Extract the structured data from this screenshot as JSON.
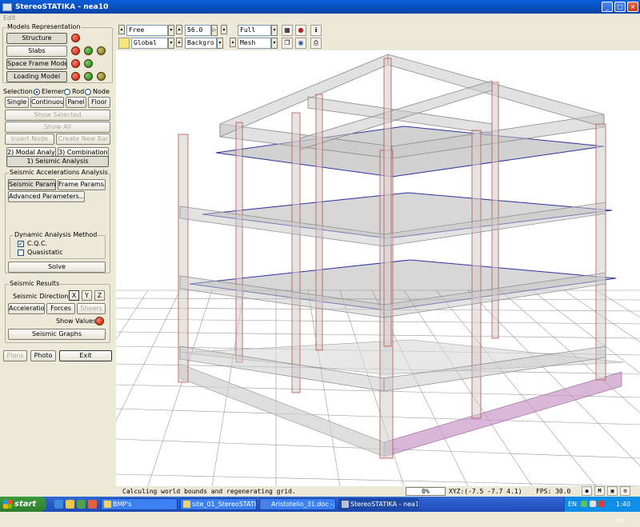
{
  "window": {
    "title": "StereoSTATIKA - nea10",
    "minimize": "_",
    "maximize": "□",
    "close": "×"
  },
  "menu": {
    "edit": "Edit"
  },
  "models": {
    "group_label": "Models Representation",
    "structure": "Structure",
    "slabs": "Slabs",
    "space_frame": "Space Frame Model",
    "loading": "Loading Model"
  },
  "selection": {
    "label": "Selection:",
    "element": "Element",
    "rod": "Rod",
    "node": "Node",
    "single": "Single",
    "continuous": "Continuous",
    "panel": "Panel",
    "floor": "Floor",
    "show_selected": "Show Selected",
    "show_all": "Show All",
    "insert_node": "Insert Node",
    "create_bar": "Create New Bar"
  },
  "tabs": {
    "modal": "2) Modal Analysis",
    "combinations": "3) Combinations",
    "seismic": "1) Seismic Analysis"
  },
  "seismic": {
    "group_label": "Seismic Accelerations Analysis",
    "seismic_params": "Seismic Params...",
    "frame_params": "Frame Params...",
    "advanced_params": "Advanced Parameters...",
    "method_label": "Dynamic Analysis Method",
    "cqc": "C.Q.C.",
    "quasistatic": "Quasistatic",
    "solve": "Solve"
  },
  "results": {
    "group_label": "Seismic Results",
    "direction_label": "Seismic Direction:",
    "x": "X",
    "y": "Y",
    "z": "Z",
    "accelerations": "Accelerations",
    "forces": "Forces",
    "shears": "Shears",
    "show_values": "Show Values:",
    "graphs": "Seismic Graphs"
  },
  "bottom_buttons": {
    "plans": "Plans",
    "photo": "Photo",
    "exit": "Exit"
  },
  "toolbar": {
    "camera_mode": "Free",
    "coord_system": "Global",
    "angle_value": "56.0",
    "background": "Backgro",
    "view_mode": "Full",
    "render_mode": "Mesh"
  },
  "status": {
    "message": "Calculing world bounds and regenerating grid.",
    "progress": "0%",
    "xyz": "XYZ:(-7.5 -7.7 4.1)",
    "fps": "FPS: 30.0",
    "m": "M"
  },
  "taskbar": {
    "start": "start",
    "tasks": [
      "BMP's",
      "site_01_StereoSTATI...",
      "Aristotelio_31.doc -...",
      "StereoSTATIKA - nea10"
    ],
    "lang": "EN",
    "clock": "1:40 μμ"
  },
  "colors": {
    "accent": "#0a5fd8",
    "red_dot": "#d01000",
    "green_dot": "#108010",
    "olive_dot": "#707010",
    "beam": "#c4c4c4",
    "column_line": "#c05050",
    "slab_edge": "#3030a0"
  }
}
